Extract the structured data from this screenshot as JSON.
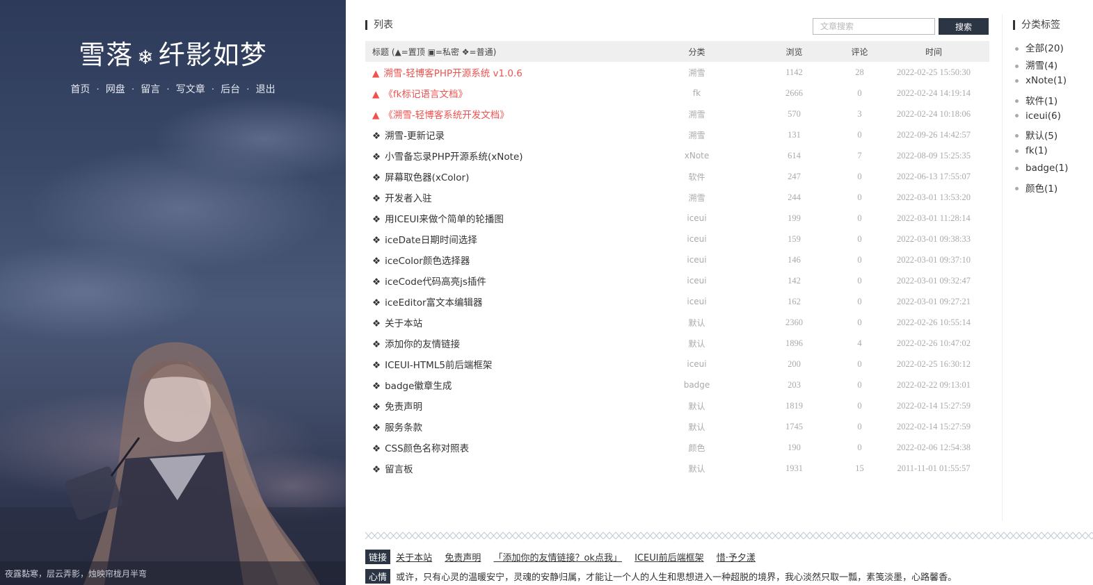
{
  "hero": {
    "title_left": "雪落",
    "title_symbol": "❄",
    "title_right": "纤影如梦",
    "nav": [
      "首页",
      "网盘",
      "留言",
      "写文章",
      "后台",
      "退出"
    ],
    "caption": "夜露黏寒，层云弄影，烛映帘栊月半弯"
  },
  "list": {
    "label": "列表",
    "search_placeholder": "文章搜索",
    "search_button": "搜索",
    "headers": {
      "title": "标题 (▲=置顶 ▣=私密 ❖=普通)",
      "category": "分类",
      "views": "浏览",
      "comments": "评论",
      "time": "时间"
    },
    "rows": [
      {
        "mark": "▲",
        "title": "溯雪-轻博客PHP开源系统 v1.0.6",
        "category": "溯雪",
        "views": "1142",
        "comments": "28",
        "time": "2022-02-25 15:50:30",
        "pin": true
      },
      {
        "mark": "▲",
        "title": "《fk标记语言文档》",
        "category": "fk",
        "views": "2666",
        "comments": "0",
        "time": "2022-02-24 14:19:14",
        "pin": true
      },
      {
        "mark": "▲",
        "title": "《溯雪-轻博客系统开发文档》",
        "category": "溯雪",
        "views": "570",
        "comments": "3",
        "time": "2022-02-24 10:18:06",
        "pin": true
      },
      {
        "mark": "❖",
        "title": "溯雪-更新记录",
        "category": "溯雪",
        "views": "131",
        "comments": "0",
        "time": "2022-09-26 14:42:57",
        "pin": false
      },
      {
        "mark": "❖",
        "title": "小雪备忘录PHP开源系统(xNote)",
        "category": "xNote",
        "views": "614",
        "comments": "7",
        "time": "2022-08-09 15:25:35",
        "pin": false
      },
      {
        "mark": "❖",
        "title": "屏幕取色器(xColor)",
        "category": "软件",
        "views": "247",
        "comments": "0",
        "time": "2022-06-13 17:55:07",
        "pin": false
      },
      {
        "mark": "❖",
        "title": "开发者入驻",
        "category": "溯雪",
        "views": "244",
        "comments": "0",
        "time": "2022-03-01 13:53:20",
        "pin": false
      },
      {
        "mark": "❖",
        "title": "用ICEUI来做个简单的轮播图",
        "category": "iceui",
        "views": "199",
        "comments": "0",
        "time": "2022-03-01 11:28:14",
        "pin": false
      },
      {
        "mark": "❖",
        "title": "iceDate日期时间选择",
        "category": "iceui",
        "views": "159",
        "comments": "0",
        "time": "2022-03-01 09:38:33",
        "pin": false
      },
      {
        "mark": "❖",
        "title": "iceColor颜色选择器",
        "category": "iceui",
        "views": "146",
        "comments": "0",
        "time": "2022-03-01 09:37:10",
        "pin": false
      },
      {
        "mark": "❖",
        "title": "iceCode代码高亮js插件",
        "category": "iceui",
        "views": "142",
        "comments": "0",
        "time": "2022-03-01 09:32:47",
        "pin": false
      },
      {
        "mark": "❖",
        "title": "iceEditor富文本编辑器",
        "category": "iceui",
        "views": "162",
        "comments": "0",
        "time": "2022-03-01 09:27:21",
        "pin": false
      },
      {
        "mark": "❖",
        "title": "关于本站",
        "category": "默认",
        "views": "2360",
        "comments": "0",
        "time": "2022-02-26 10:55:14",
        "pin": false
      },
      {
        "mark": "❖",
        "title": "添加你的友情链接",
        "category": "默认",
        "views": "1896",
        "comments": "4",
        "time": "2022-02-26 10:47:02",
        "pin": false
      },
      {
        "mark": "❖",
        "title": "ICEUI-HTML5前后端框架",
        "category": "iceui",
        "views": "200",
        "comments": "0",
        "time": "2022-02-25 16:30:12",
        "pin": false
      },
      {
        "mark": "❖",
        "title": "badge徽章生成",
        "category": "badge",
        "views": "203",
        "comments": "0",
        "time": "2022-02-22 09:13:01",
        "pin": false
      },
      {
        "mark": "❖",
        "title": "免责声明",
        "category": "默认",
        "views": "1819",
        "comments": "0",
        "time": "2022-02-14 15:27:59",
        "pin": false
      },
      {
        "mark": "❖",
        "title": "服务条款",
        "category": "默认",
        "views": "1745",
        "comments": "0",
        "time": "2022-02-14 15:27:59",
        "pin": false
      },
      {
        "mark": "❖",
        "title": "CSS颜色名称对照表",
        "category": "颜色",
        "views": "190",
        "comments": "0",
        "time": "2022-02-06 12:54:38",
        "pin": false
      },
      {
        "mark": "❖",
        "title": "留言板",
        "category": "默认",
        "views": "1931",
        "comments": "15",
        "time": "2011-11-01 01:55:57",
        "pin": false
      }
    ]
  },
  "sidebar": {
    "label": "分类标签",
    "tags": [
      "全部(20)",
      "溯雪(4)",
      "xNote(1)",
      "软件(1)",
      "iceui(6)",
      "默认(5)",
      "fk(1)",
      "badge(1)",
      "颜色(1)"
    ]
  },
  "footer": {
    "links_badge": "链接",
    "links": [
      "关于本站",
      "免责声明",
      "「添加你的友情链接？ok点我」",
      "ICEUI前后端框架",
      "惜·予夕漾"
    ],
    "mood_badge": "心情",
    "mood_text": "或许，只有心灵的温暖安宁，灵魂的安静归属，才能让一个人的人生和思想进入一种超脱的境界，我心淡然只取一瓢，素笺淡墨，心路馨香。"
  },
  "colors": {
    "pin_red": "#ef5350",
    "dark_button": "#2b3544",
    "hero_bg": "#3a4868"
  }
}
